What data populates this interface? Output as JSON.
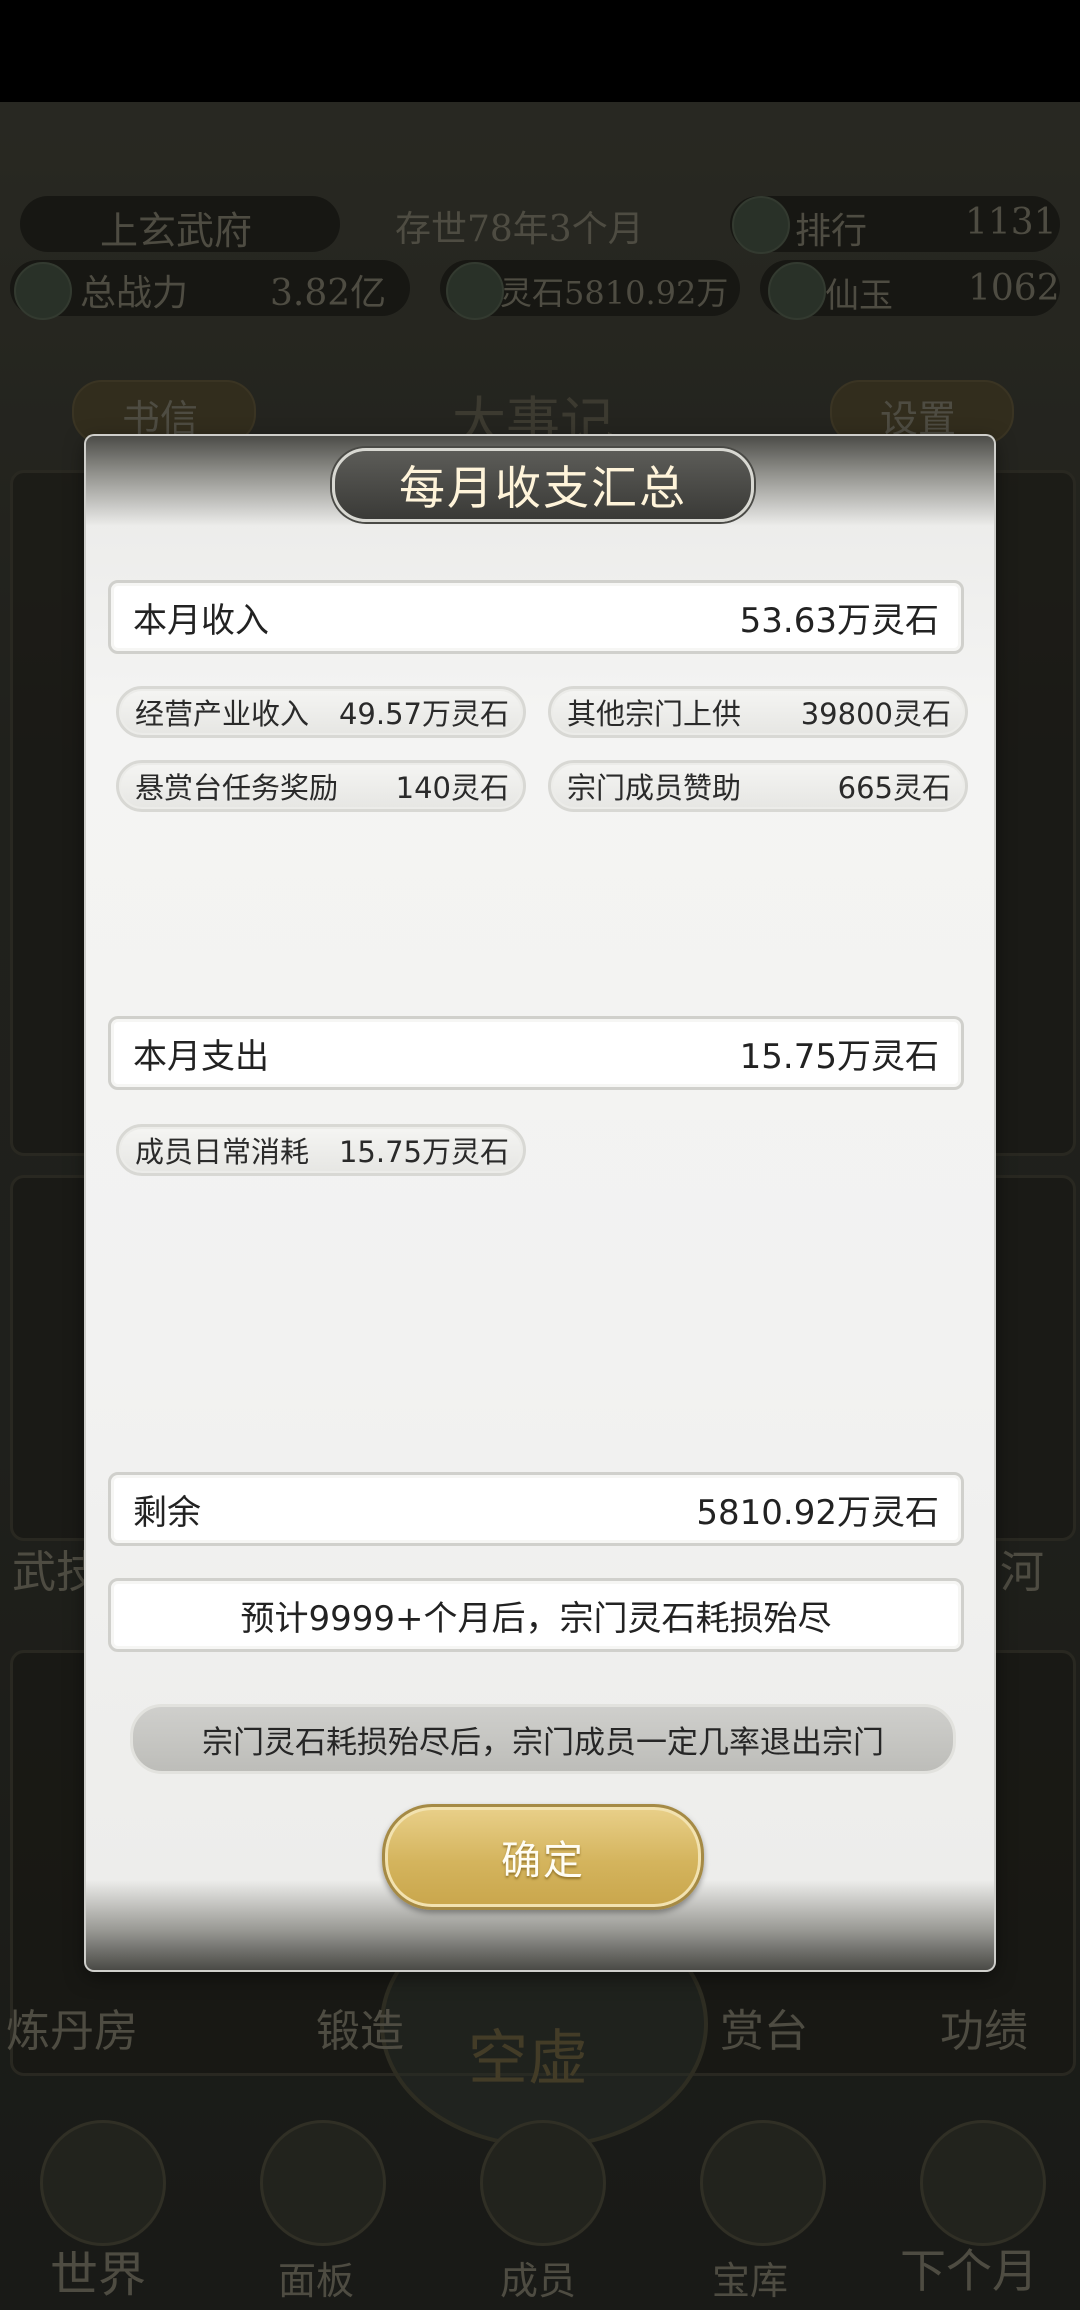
{
  "background": {
    "sect_name": "上玄武府",
    "era": "存世78年3个月",
    "rank_label": "排行",
    "rank_value": "1131",
    "power_label": "总战力",
    "power_value": "3.82亿",
    "spirit_stone": "灵石5810.92万",
    "jade_label": "仙玉",
    "jade_value": "1062",
    "letter_button": "书信",
    "event_title": "大事记",
    "settings_button": "设置",
    "buildings": [
      "炼丹房",
      "锻造",
      "赏台",
      "功绩"
    ],
    "side_left": "武技",
    "side_right": "河",
    "center_seal": "空虚",
    "nav": [
      "世界",
      "面板",
      "成员",
      "宝库",
      "下个月"
    ]
  },
  "modal": {
    "title": "每月收支汇总",
    "income": {
      "label": "本月收入",
      "value": "53.63万灵石"
    },
    "income_items": [
      {
        "label": "经营产业收入",
        "value": "49.57万灵石"
      },
      {
        "label": "其他宗门上供",
        "value": "39800灵石"
      },
      {
        "label": "悬赏台任务奖励",
        "value": "140灵石"
      },
      {
        "label": "宗门成员赞助",
        "value": "665灵石"
      }
    ],
    "expense": {
      "label": "本月支出",
      "value": "15.75万灵石"
    },
    "expense_items": [
      {
        "label": "成员日常消耗",
        "value": "15.75万灵石"
      }
    ],
    "remaining": {
      "label": "剩余",
      "value": "5810.92万灵石"
    },
    "forecast": "预计9999+个月后，宗门灵石耗损殆尽",
    "notice": "宗门灵石耗损殆尽后，宗门成员一定几率退出宗门",
    "confirm_label": "确定"
  }
}
